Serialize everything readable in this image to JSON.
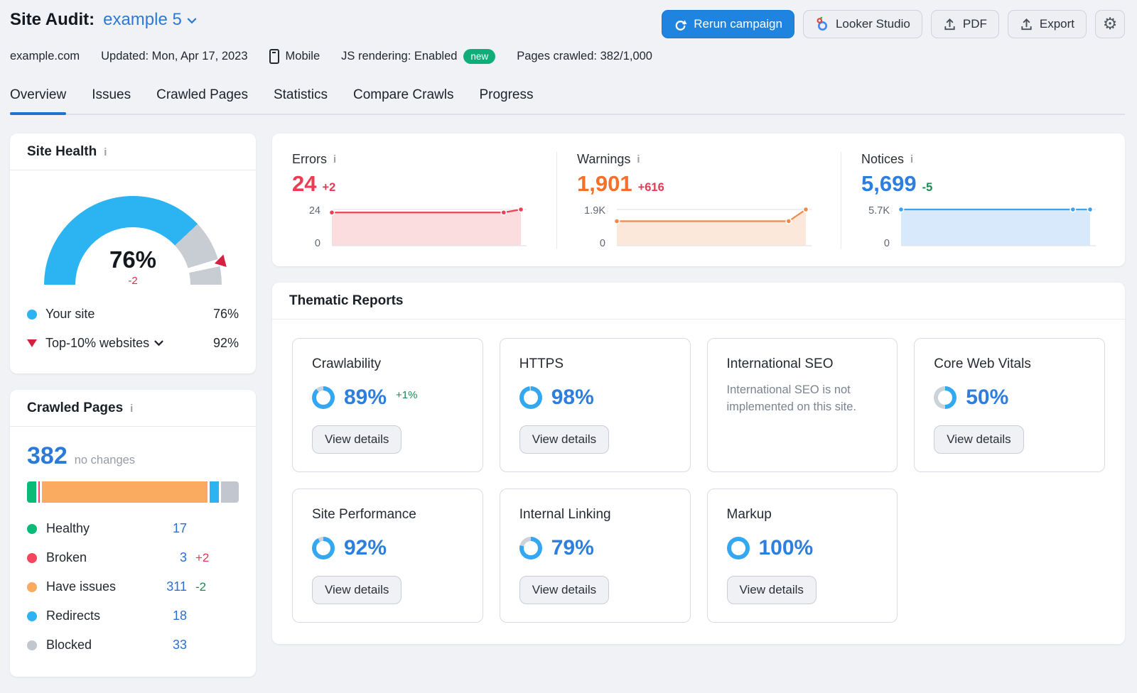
{
  "header": {
    "title": "Site Audit:",
    "project": "example 5",
    "rerun": "Rerun campaign",
    "looker": "Looker Studio",
    "pdf": "PDF",
    "export": "Export",
    "domain": "example.com",
    "updated": "Updated: Mon, Apr 17, 2023",
    "device": "Mobile",
    "js_rendering": "JS rendering: Enabled",
    "new_badge": "new",
    "pages_crawled": "Pages crawled: 382/1,000"
  },
  "tabs": [
    {
      "label": "Overview"
    },
    {
      "label": "Issues"
    },
    {
      "label": "Crawled Pages"
    },
    {
      "label": "Statistics"
    },
    {
      "label": "Compare Crawls"
    },
    {
      "label": "Progress"
    }
  ],
  "site_health": {
    "title": "Site Health",
    "score": 76,
    "score_label": "76%",
    "delta": "-2",
    "benchmark": 92,
    "legend_site_label": "Your site",
    "legend_site_value": "76%",
    "legend_top_label": "Top-10% websites",
    "legend_top_value": "92%"
  },
  "metrics": [
    {
      "name": "Errors",
      "value": "24",
      "delta": "+2",
      "ymax_label": "24",
      "ymin_label": "0",
      "values": [
        22,
        22,
        22,
        22,
        22,
        22,
        22,
        22,
        22,
        22,
        22,
        24
      ],
      "line": "#ef4156",
      "fill": "#fbdcdf"
    },
    {
      "name": "Warnings",
      "value": "1,901",
      "delta": "+616",
      "ymax_label": "1.9K",
      "ymin_label": "0",
      "values": [
        1285,
        1285,
        1285,
        1285,
        1285,
        1285,
        1285,
        1285,
        1285,
        1285,
        1285,
        1901
      ],
      "line": "#f18a47",
      "fill": "#fce8da"
    },
    {
      "name": "Notices",
      "value": "5,699",
      "delta": "-5",
      "ymax_label": "5.7K",
      "ymin_label": "0",
      "values": [
        5704,
        5704,
        5704,
        5704,
        5704,
        5704,
        5704,
        5704,
        5704,
        5704,
        5704,
        5699
      ],
      "line": "#3da2ee",
      "fill": "#d7e9fa"
    }
  ],
  "crawled_pages": {
    "title": "Crawled Pages",
    "total": "382",
    "total_note": "no changes",
    "rows": [
      {
        "label": "Healthy",
        "count": "17",
        "delta": "",
        "color": "#0cba77"
      },
      {
        "label": "Broken",
        "count": "3",
        "delta": "+2",
        "color": "#f4465c"
      },
      {
        "label": "Have issues",
        "count": "311",
        "delta": "-2",
        "color": "#fbab60"
      },
      {
        "label": "Redirects",
        "count": "18",
        "delta": "",
        "color": "#2bb3f2"
      },
      {
        "label": "Blocked",
        "count": "33",
        "delta": "",
        "color": "#c2c7cf"
      }
    ]
  },
  "thematic": {
    "title": "Thematic Reports",
    "view_details": "View details",
    "cards": [
      {
        "name": "Crawlability",
        "percent": 89,
        "percent_label": "89%",
        "delta": "+1%"
      },
      {
        "name": "HTTPS",
        "percent": 98,
        "percent_label": "98%"
      },
      {
        "name": "International SEO",
        "description": "International SEO is not implemented on this site."
      },
      {
        "name": "Core Web Vitals",
        "percent": 50,
        "percent_label": "50%"
      },
      {
        "name": "Site Performance",
        "percent": 92,
        "percent_label": "92%"
      },
      {
        "name": "Internal Linking",
        "percent": 79,
        "percent_label": "79%"
      },
      {
        "name": "Markup",
        "percent": 100,
        "percent_label": "100%"
      }
    ]
  }
}
